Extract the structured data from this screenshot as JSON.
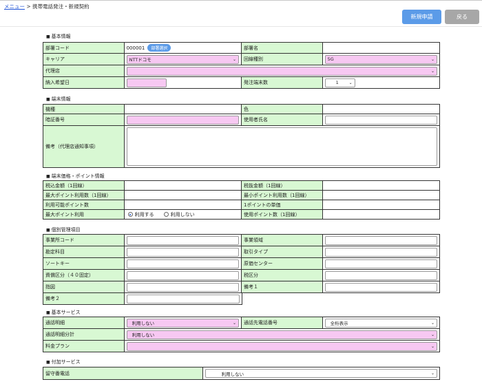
{
  "breadcrumb": {
    "menu": "メニュー",
    "separator": ">",
    "current": "携帯電話発注・新規契約"
  },
  "buttons": {
    "new_apply": "新規申請",
    "back": "戻る"
  },
  "basic": {
    "title": "基本情報",
    "dept_code_label": "部署コード",
    "dept_code_value": "000001",
    "dept_select_button": "部署選択",
    "dept_name_label": "部署名",
    "carrier_label": "キャリア",
    "carrier_value": "NTTドコモ",
    "line_type_label": "回線種別",
    "line_type_value": "5G",
    "agency_label": "代理店",
    "delivery_label": "納入希望日",
    "order_count_label": "発注端末数",
    "order_count_value": "1"
  },
  "terminal": {
    "title": "端末情報",
    "model_label": "機種",
    "color_label": "色",
    "auth_label": "暗証番号",
    "user_label": "使用者氏名",
    "remarks_label": "備考（代理店通知事項）"
  },
  "price": {
    "title": "端末価格・ポイント情報",
    "tax_incl_label": "税込金額（1回線）",
    "tax_excl_label": "税抜金額（1回線）",
    "max_point_label": "最大ポイント利用数（1回線）",
    "min_point_label": "最小ポイント利用数（1回線）",
    "avail_point_label": "利用可能ポイント数",
    "unit_price_label": "1ポイントの単価",
    "max_use_label": "最大ポイント利用",
    "use_yes": "利用する",
    "use_no": "利用しない",
    "used_point_label": "使用ポイント数（1回線）"
  },
  "mgmt": {
    "title": "個別管理項目",
    "office_code": "事業所コード",
    "business_area": "事業領域",
    "account": "勘定科目",
    "trade_type": "取引タイプ",
    "sort_key": "ソートキー",
    "cost_center": "原価センター",
    "asset_cat": "資償区分（４０固定）",
    "tax_cat": "税区分",
    "route": "指図",
    "note1": "備考１",
    "note2": "備考２"
  },
  "basic_service": {
    "title": "基本サービス",
    "call_detail_label": "通話明細",
    "call_detail_value": "利用しない",
    "call_dest_label": "通話先電話番号",
    "call_dest_value": "全桁表示",
    "call_total_label": "通話明細分計",
    "call_total_value": "利用しない",
    "plan_label": "料金プラン"
  },
  "extra_service": {
    "title": "付加サービス",
    "voicemail_label": "留守番電話",
    "voicemail_value": "利用しない"
  }
}
